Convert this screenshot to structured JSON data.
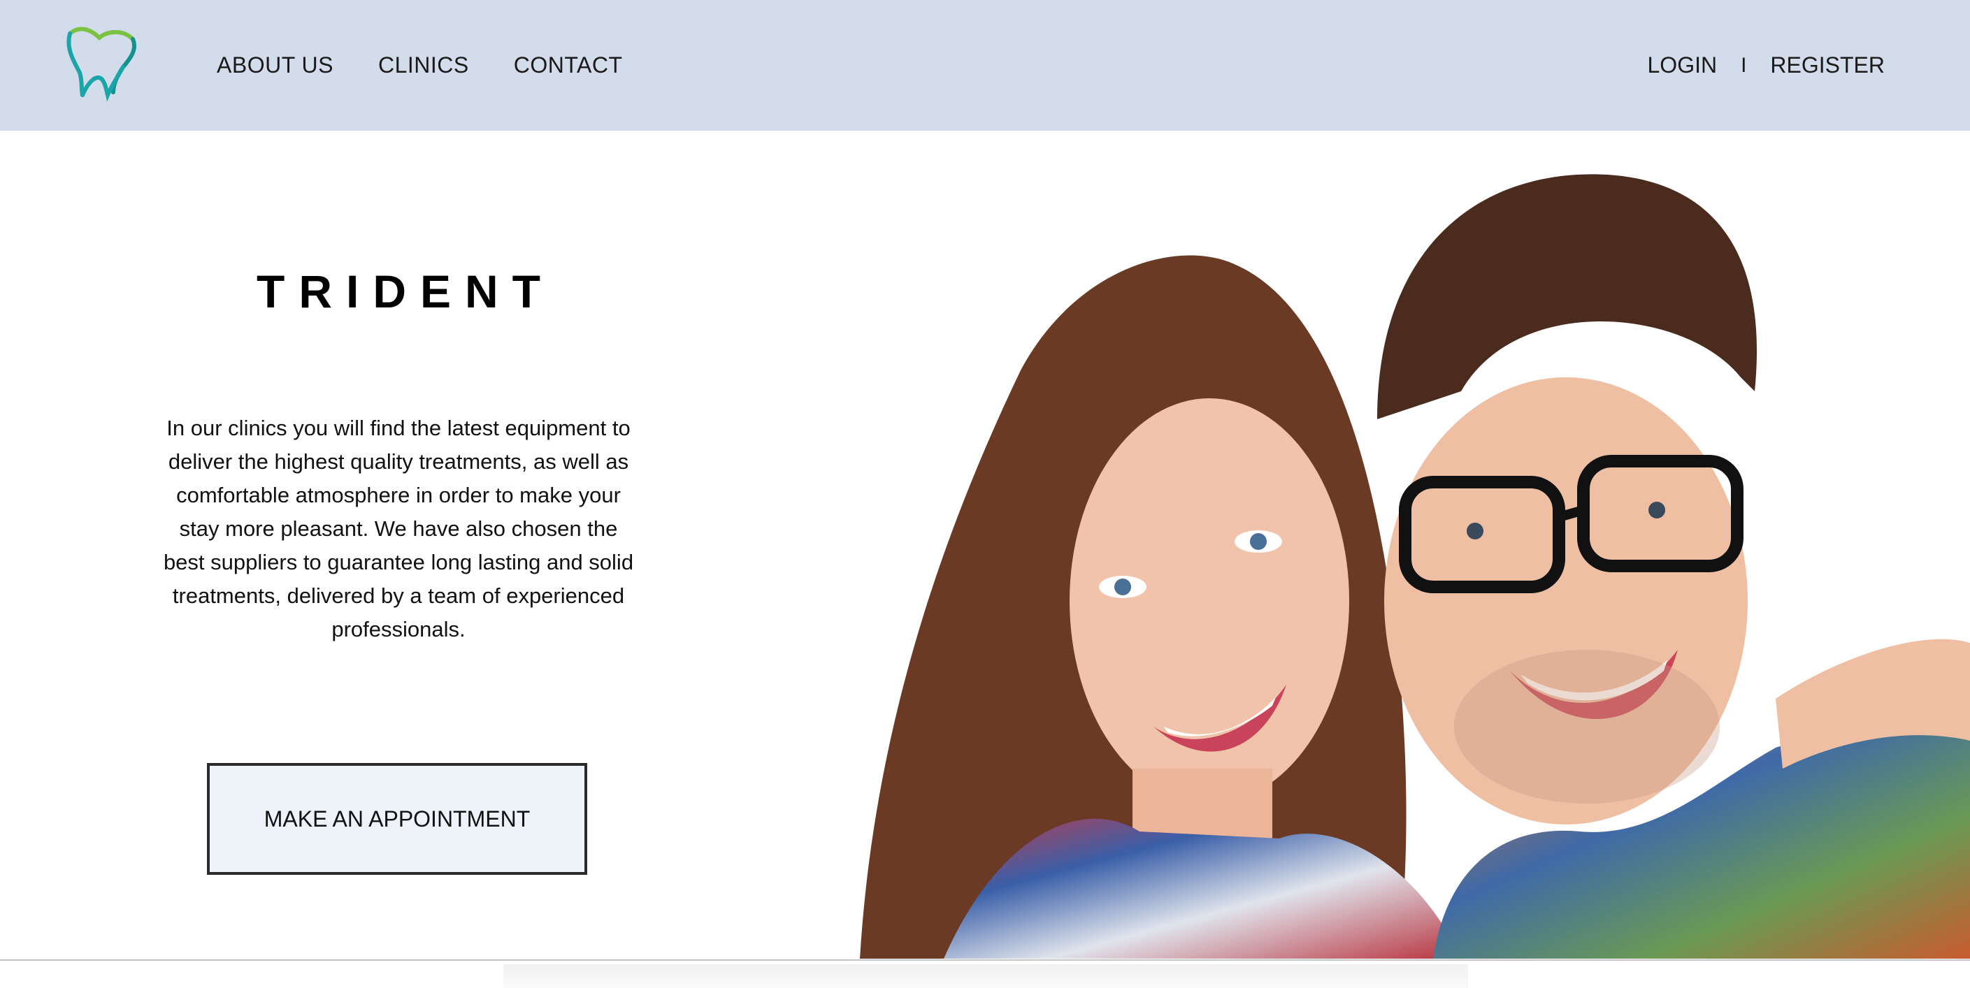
{
  "header": {
    "logo_icon": "tooth-icon",
    "nav": [
      {
        "label": "ABOUT US"
      },
      {
        "label": "CLINICS"
      },
      {
        "label": "CONTACT"
      }
    ],
    "auth": {
      "login": "LOGIN",
      "separator": "I",
      "register": "REGISTER"
    }
  },
  "hero": {
    "brand": "TRIDENT",
    "description": "In our clinics you will find the latest equipment to deliver the highest quality treatments, as well as comfortable atmosphere in order to make your stay more pleasant. We have also chosen the best suppliers to guarantee long lasting and solid treatments, delivered by a team of experienced professionals.",
    "cta": "MAKE AN APPOINTMENT",
    "photo_icon": "smiling-couple-image"
  },
  "colors": {
    "header_bg": "#d2dcea",
    "cta_bg": "#eef3fa",
    "logo_green": "#7cc242",
    "logo_teal": "#1aa5a8"
  }
}
